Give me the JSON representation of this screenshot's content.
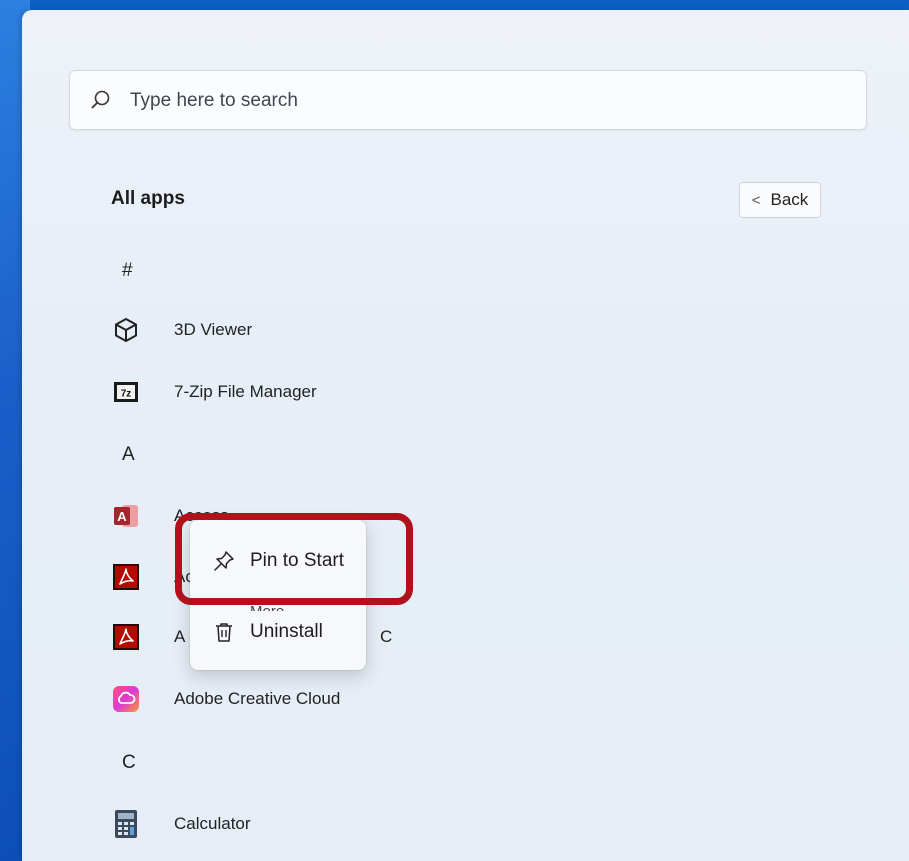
{
  "search": {
    "placeholder": "Type here to search"
  },
  "header": {
    "title": "All apps",
    "back_label": "Back"
  },
  "sections": [
    {
      "letter": "#",
      "apps": [
        {
          "label": "3D Viewer",
          "icon": "cube-icon"
        },
        {
          "label": "7-Zip File Manager",
          "icon": "7zip-icon"
        }
      ]
    },
    {
      "letter": "A",
      "apps": [
        {
          "label": "Access",
          "icon": "access-icon"
        },
        {
          "label": "Ac",
          "icon": "acrobat-icon"
        },
        {
          "label": "A",
          "icon": "acrobat-icon"
        },
        {
          "label": "Adobe Creative Cloud",
          "icon": "creative-cloud-icon"
        }
      ]
    },
    {
      "letter": "C",
      "apps": [
        {
          "label": "Calculator",
          "icon": "calculator-icon"
        }
      ]
    }
  ],
  "app_partial_suffix": "C",
  "context_menu": {
    "pin_label": "Pin to Start",
    "more_label": "More",
    "uninstall_label": "Uninstall"
  },
  "colors": {
    "highlight": "#b0121b",
    "access_red": "#a4262c",
    "acrobat_red": "#b30b00"
  }
}
